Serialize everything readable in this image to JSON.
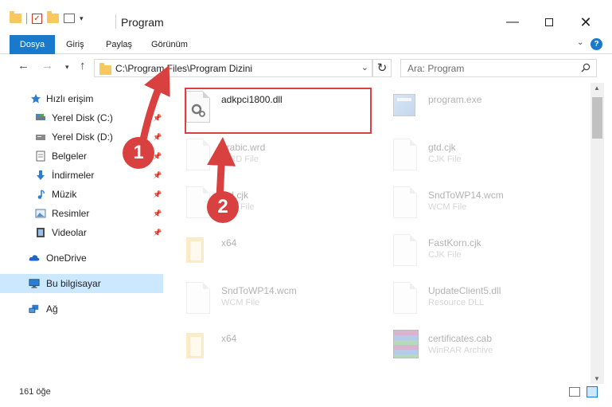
{
  "window": {
    "title": "Program",
    "minimize": "—",
    "close": "✕"
  },
  "ribbon": {
    "tabs": [
      "Dosya",
      "Giriş",
      "Paylaş",
      "Görünüm"
    ],
    "help": "?"
  },
  "address": {
    "path": "C:\\Program Files\\Program Dizini",
    "search_placeholder": "Ara: Program"
  },
  "sidebar": {
    "quick_access": "Hızlı erişim",
    "items": [
      {
        "label": "Yerel Disk (C:)",
        "icon": "drive-icon"
      },
      {
        "label": "Yerel Disk (D:)",
        "icon": "drive-icon"
      },
      {
        "label": "Belgeler",
        "icon": "documents-icon"
      },
      {
        "label": "İndirmeler",
        "icon": "download-icon"
      },
      {
        "label": "Müzik",
        "icon": "music-icon"
      },
      {
        "label": "Resimler",
        "icon": "pictures-icon"
      },
      {
        "label": "Videolar",
        "icon": "video-icon"
      }
    ],
    "onedrive": "OneDrive",
    "this_pc": "Bu bilgisayar",
    "network": "Ağ"
  },
  "files": [
    {
      "name": "adkpci1800.dll",
      "type": "",
      "icon": "dll-icon",
      "highlighted": true
    },
    {
      "name": "program.exe",
      "type": "",
      "icon": "exe-icon"
    },
    {
      "name": "arabic.wrd",
      "type": "WRD File",
      "icon": "file-icon"
    },
    {
      "name": "gtd.cjk",
      "type": "CJK File",
      "icon": "file-icon"
    },
    {
      "name": "std.cjk",
      "type": "CJK File",
      "icon": "file-icon"
    },
    {
      "name": "SndToWP14.wcm",
      "type": "WCM File",
      "icon": "file-icon"
    },
    {
      "name": "x64",
      "type": "",
      "icon": "folder-icon"
    },
    {
      "name": "FastKorn.cjk",
      "type": "CJK File",
      "icon": "file-icon"
    },
    {
      "name": "SndToWP14.wcm",
      "type": "WCM File",
      "icon": "file-icon"
    },
    {
      "name": "UpdateClient5.dll",
      "type": "Resource DLL",
      "icon": "dll-icon"
    },
    {
      "name": "x64",
      "type": "",
      "icon": "folder-icon"
    },
    {
      "name": "certificates.cab",
      "type": "WinRAR Archive",
      "icon": "archive-icon"
    }
  ],
  "status": {
    "count": "161 öğe"
  },
  "annotations": {
    "step1": "1",
    "step2": "2",
    "color": "#d8413f"
  },
  "colors": {
    "accent": "#1979ca",
    "selection": "#cce8ff"
  }
}
